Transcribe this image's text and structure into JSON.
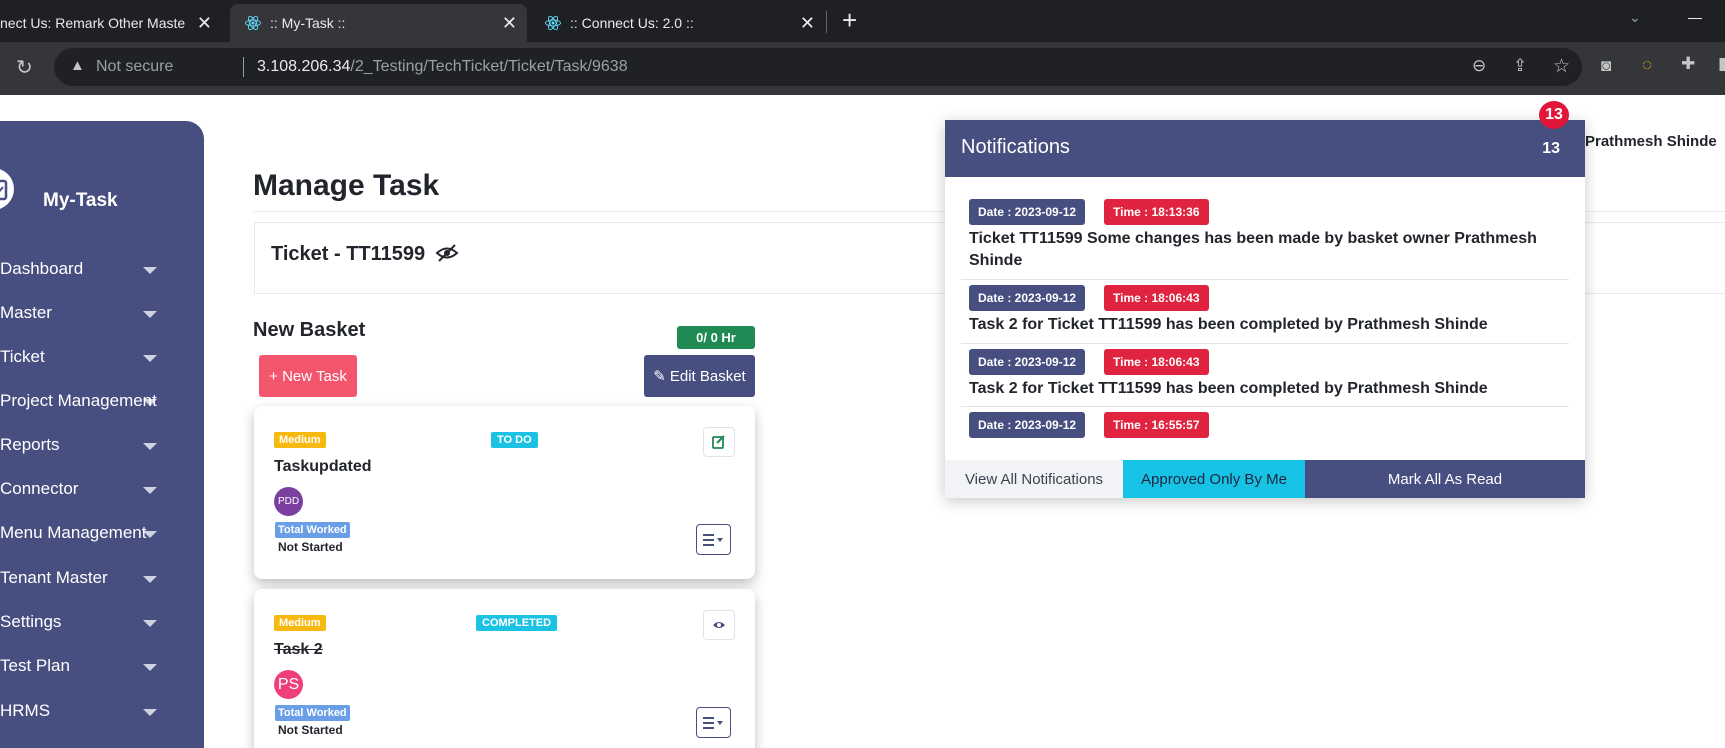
{
  "browser": {
    "tabs": [
      {
        "title": "nect Us: Remark Other Maste",
        "active": false
      },
      {
        "title": ":: My-Task ::",
        "active": true
      },
      {
        "title": ":: Connect Us: 2.0 ::",
        "active": false
      }
    ],
    "new_tab_label": "+",
    "security_label": "Not secure",
    "url_host": "3.108.206.34",
    "url_path": "/2_Testing/TechTicket/Ticket/Task/9638"
  },
  "sidebar": {
    "brand": "My-Task",
    "items": [
      {
        "label": "Dashboard"
      },
      {
        "label": "Master"
      },
      {
        "label": "Ticket"
      },
      {
        "label": "Project Management"
      },
      {
        "label": "Reports"
      },
      {
        "label": "Connector"
      },
      {
        "label": "Menu Management"
      },
      {
        "label": "Tenant Master"
      },
      {
        "label": "Settings"
      },
      {
        "label": "Test Plan"
      },
      {
        "label": "HRMS"
      }
    ]
  },
  "header": {
    "notification_badge": "13",
    "user_name": "Prathmesh Shinde"
  },
  "main": {
    "page_title": "Manage Task",
    "ticket_label": "Ticket - TT11599",
    "basket_title": "New Basket",
    "hours": "0/ 0 Hr",
    "new_task_button": "+ New Task",
    "edit_basket_button": "Edit Basket",
    "tasks": [
      {
        "priority": "Medium",
        "status": "TO DO",
        "title": "Taskupdated",
        "avatar": "PDD",
        "avatar_color": "#7b3fa0",
        "worked_label": "Total Worked",
        "work_status": "Not Started"
      },
      {
        "priority": "Medium",
        "status": "COMPLETED",
        "title": "Task 2",
        "avatar": "PS",
        "avatar_color": "#f03e7d",
        "worked_label": "Total Worked",
        "work_status": "Not Started"
      }
    ]
  },
  "notifications": {
    "title": "Notifications",
    "count": "13",
    "items": [
      {
        "date": "Date : 2023-09-12",
        "time": "Time : 18:13:36",
        "message": "Ticket TT11599 Some changes has been made by basket owner Prathmesh Shinde"
      },
      {
        "date": "Date : 2023-09-12",
        "time": "Time : 18:06:43",
        "message": "Task 2 for Ticket TT11599 has been completed by Prathmesh Shinde"
      },
      {
        "date": "Date : 2023-09-12",
        "time": "Time : 18:06:43",
        "message": "Task 2 for Ticket TT11599 has been completed by Prathmesh Shinde"
      },
      {
        "date": "Date : 2023-09-12",
        "time": "Time : 16:55:57",
        "message": ""
      }
    ],
    "view_all": "View All Notifications",
    "approved_only": "Approved Only By Me",
    "mark_all_read": "Mark All As Read"
  },
  "colors": {
    "brand": "#474e80",
    "danger": "#e0233f",
    "info": "#17c3e5",
    "warning": "#f7b810",
    "success": "#1f8a53"
  }
}
